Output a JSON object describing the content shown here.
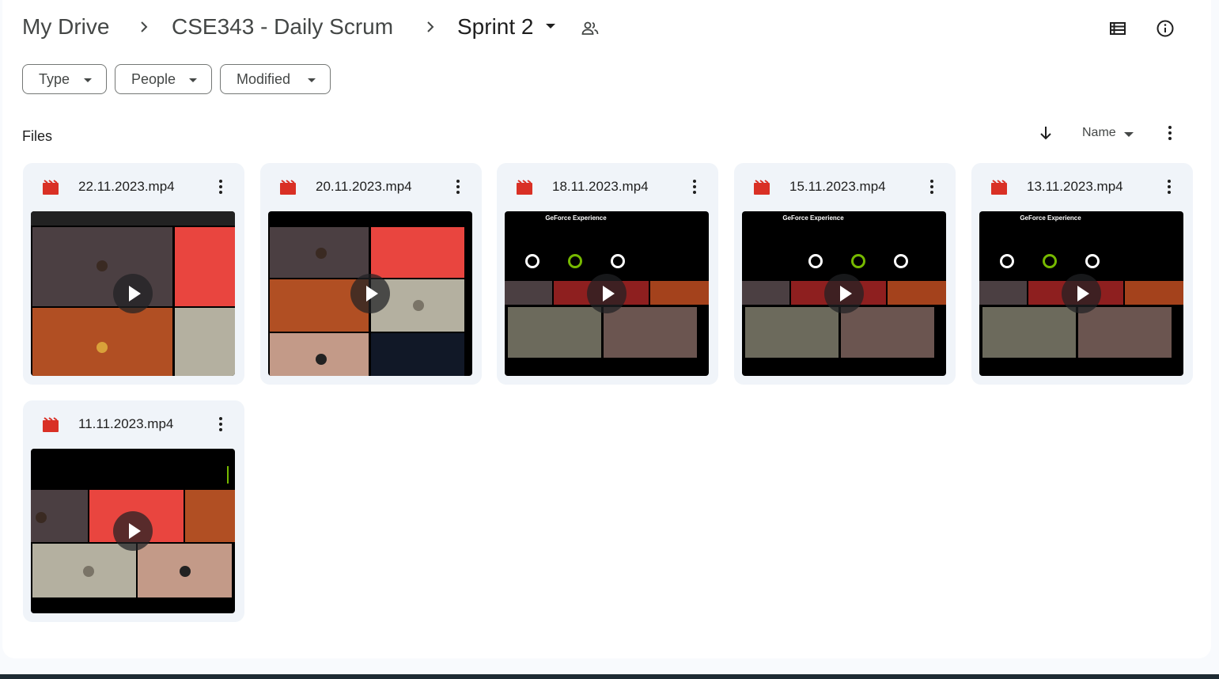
{
  "breadcrumb": {
    "root": "My Drive",
    "folder": "CSE343 - Daily Scrum",
    "current": "Sprint 2"
  },
  "filters": [
    {
      "label": "Type"
    },
    {
      "label": "People"
    },
    {
      "label": "Modified"
    }
  ],
  "section": {
    "label": "Files",
    "sort_label": "Name"
  },
  "files": [
    {
      "name": "22.11.2023.mp4",
      "thumb_title": ""
    },
    {
      "name": "20.11.2023.mp4",
      "thumb_title": ""
    },
    {
      "name": "18.11.2023.mp4",
      "thumb_title": "GeForce Experience"
    },
    {
      "name": "15.11.2023.mp4",
      "thumb_title": "GeForce Experience"
    },
    {
      "name": "13.11.2023.mp4",
      "thumb_title": "GeForce Experience"
    },
    {
      "name": "11.11.2023.mp4",
      "thumb_title": ""
    }
  ],
  "icons": {
    "folder_caret": "caret-down-icon",
    "share": "people-icon",
    "view_toggle": "list-view-icon",
    "details": "info-icon",
    "sort_direction": "arrow-down-icon",
    "file_type": "video-icon"
  },
  "colors": {
    "video_icon": "#d93025",
    "card_bg": "#f0f4f9",
    "nvidia_green": "#76b900"
  }
}
